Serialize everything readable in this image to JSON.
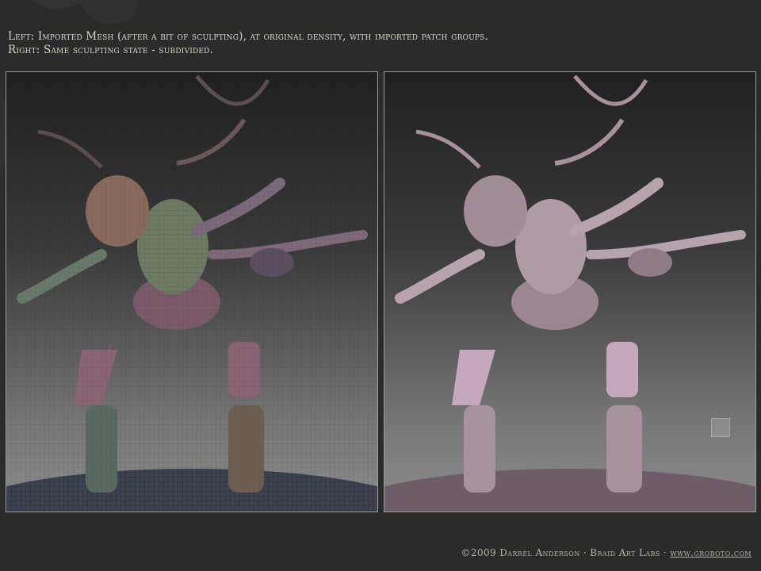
{
  "caption": {
    "line1": "Left: Imported Mesh (after a bit of sculpting), at original density, with imported patch groups.",
    "line2": "Right: Same sculpting state - subdivided."
  },
  "panels": [
    {
      "id": "left",
      "description": "imported mesh with patch groups"
    },
    {
      "id": "right",
      "description": "subdivided mesh"
    }
  ],
  "footer": {
    "credit": "©2009 Darrel Anderson · Braid Art Labs · ",
    "link": "www.groboto.com"
  },
  "colors": {
    "background": "#2b2b2b",
    "caption": "#d9d4c3",
    "panel_border": "#9aa08f",
    "subdivided_tone": "#b7a2b0"
  }
}
